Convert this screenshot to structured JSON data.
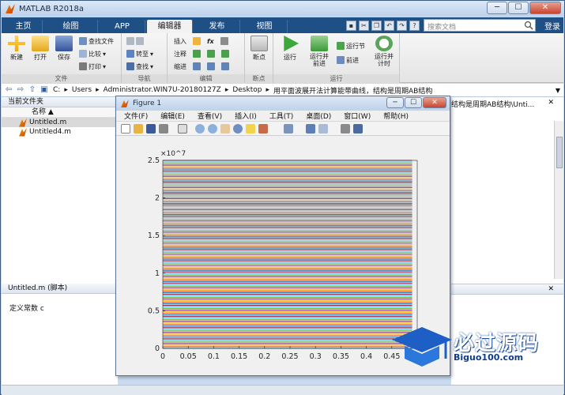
{
  "window": {
    "title": "MATLAB R2018a"
  },
  "tabs": [
    {
      "label": "主页"
    },
    {
      "label": "绘图"
    },
    {
      "label": "APP"
    },
    {
      "label": "编辑器"
    },
    {
      "label": "发布"
    },
    {
      "label": "视图"
    }
  ],
  "search": {
    "placeholder": "搜索文档"
  },
  "login": "登录",
  "ribbon": {
    "file": {
      "group": "文件",
      "new": "新建",
      "open": "打开",
      "save": "保存",
      "find_files": "查找文件",
      "compare": "比较",
      "print": "打印"
    },
    "nav": {
      "group": "导航",
      "goto": "转至",
      "find": "查找"
    },
    "edit": {
      "group": "编辑",
      "insert": "插入",
      "comment": "注释",
      "indent": "缩进",
      "fx": "fx"
    },
    "breakpoints": {
      "group": "断点",
      "label": "断点"
    },
    "run": {
      "group": "运行",
      "run": "运行",
      "run_advance": "运行并\n前进",
      "run_section": "运行节",
      "advance": "前进",
      "run_time": "运行并\n计时"
    }
  },
  "address": {
    "segments": [
      "C:",
      "Users",
      "Administrator.WIN7U-20180127Z",
      "Desktop",
      "用平面波展开法计算能带曲线，结构是周期AB结构"
    ]
  },
  "current_folder": {
    "title": "当前文件夹",
    "column": "名称 ▲",
    "files": [
      {
        "name": "Untitled.m",
        "selected": true
      },
      {
        "name": "Untitled4.m",
        "selected": false
      }
    ]
  },
  "details": {
    "title": "Untitled.m  (脚本)",
    "text": "定义常数 c"
  },
  "right_header": "结构是周期AB结构\\Unti...",
  "figure": {
    "title": "Figure 1",
    "menu": [
      "文件(F)",
      "编辑(E)",
      "查看(V)",
      "插入(I)",
      "工具(T)",
      "桌面(D)",
      "窗口(W)",
      "帮助(H)"
    ],
    "chart_data": {
      "type": "line",
      "title": "",
      "xlabel": "",
      "ylabel": "",
      "xlim": [
        0,
        0.5
      ],
      "ylim": [
        0,
        2.5
      ],
      "y_exponent": "×10^7",
      "x_ticks": [
        "0",
        "0.05",
        "0.1",
        "0.15",
        "0.2",
        "0.25",
        "0.3",
        "0.35",
        "0.4",
        "0.45"
      ],
      "y_ticks": [
        "0",
        "0.5",
        "1",
        "1.5",
        "2",
        "2.5"
      ],
      "series_count": "many horizontal lines spanning y 0 to 2.5e7"
    }
  },
  "watermark": {
    "name": "必过源码",
    "site": "Biguo100.com"
  },
  "colors": {
    "tab_bar": "#1e4f85",
    "line_palette": [
      "#0072bd",
      "#d95319",
      "#edb120",
      "#7e2f8e",
      "#77ac30",
      "#4dbeee",
      "#a2142f"
    ]
  }
}
